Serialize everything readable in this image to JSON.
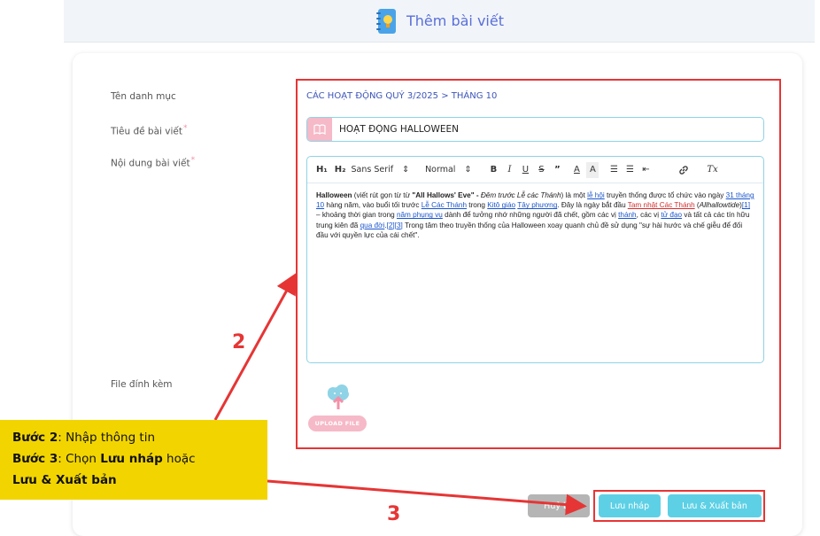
{
  "header": {
    "title": "Thêm bài viết",
    "icon": "notebook-lightbulb-icon"
  },
  "form": {
    "category_label": "Tên danh mục",
    "category_value": "CÁC HOẠT ĐỘNG QUÝ 3/2025 > THÁNG 10",
    "title_label": "Tiêu đề bài viết",
    "title_value": "HOẠT ĐỘNG HALLOWEEN",
    "content_label": "Nội dung bài viết",
    "attachment_label": "File đính kèm",
    "required_mark": "*"
  },
  "toolbar": {
    "h1": "H₁",
    "h2": "H₂",
    "font": "Sans Serif",
    "size": "Normal",
    "bold": "B",
    "italic": "I",
    "underline": "U",
    "strike": "S",
    "quote": "”",
    "font_color": "A",
    "bg_color": "A",
    "ordered_list": "☰",
    "bullet_list": "☰",
    "indent": "⇤",
    "link": "🔗",
    "clear": "Tx"
  },
  "editor_content": {
    "p1": "Halloween",
    "p2": " (viết rút gọn từ từ ",
    "p3": "\"All Hallows' Eve\"",
    "p4": " - ",
    "p5": "Đêm trước Lễ các Thánh",
    "p6": ") là một ",
    "link1": "lễ hội",
    "p7": " truyền thống được tổ chức vào ngày ",
    "link2": "31 tháng 10",
    "p8": " hàng năm, vào buổi tối trước ",
    "link3": "Lễ Các Thánh",
    "p9": " trong ",
    "link4": "Kitô giáo",
    "p10": " ",
    "link5": "Tây phương",
    "p11": ". Đây là ngày bắt đầu ",
    "link6": "Tam nhật Các Thánh",
    "p12": " (",
    "p13": "Allhallowtide",
    "p14": ")",
    "link7": "[1]",
    "p15": " – khoảng thời gian trong ",
    "link8": "năm phụng vụ",
    "p16": " dành để tưởng nhớ những người đã chết, gồm các vị ",
    "link9": "thánh",
    "p17": ", các vị ",
    "link10": "tử đạo",
    "p18": " và tất cả các tín hữu trung kiên đã ",
    "link11": "qua đời",
    "p19": ".",
    "link12": "[2][3]",
    "p20": " Trong tâm theo truyền thống của Halloween xoay quanh chủ đề sử dụng \"sự hài hước và chế giễu để đối đầu với quyền lực của cái chết\"."
  },
  "upload": {
    "label": "UPLOAD FILE",
    "icon": "cloud-upload-icon"
  },
  "actions": {
    "cancel": "Huỷ bỏ",
    "draft": "Lưu nháp",
    "publish": "Lưu & Xuất bản"
  },
  "annotation": {
    "step2_label": "Bước 2",
    "step2_text": ": Nhập thông tin",
    "step3_label": "Bước 3",
    "step3_text1": ": Chọn ",
    "step3_bold1": "Lưu nháp",
    "step3_text2": " hoặc",
    "step3_bold2": "Lưu & Xuất bản",
    "num2": "2",
    "num3": "3"
  },
  "colors": {
    "accent_blue": "#5a6fd8",
    "pink": "#f6b9c7",
    "teal_button": "#5ed0e5",
    "cancel_gray": "#b5b5b5",
    "annotation_red": "#e63535",
    "callout_yellow": "#f2d500"
  }
}
